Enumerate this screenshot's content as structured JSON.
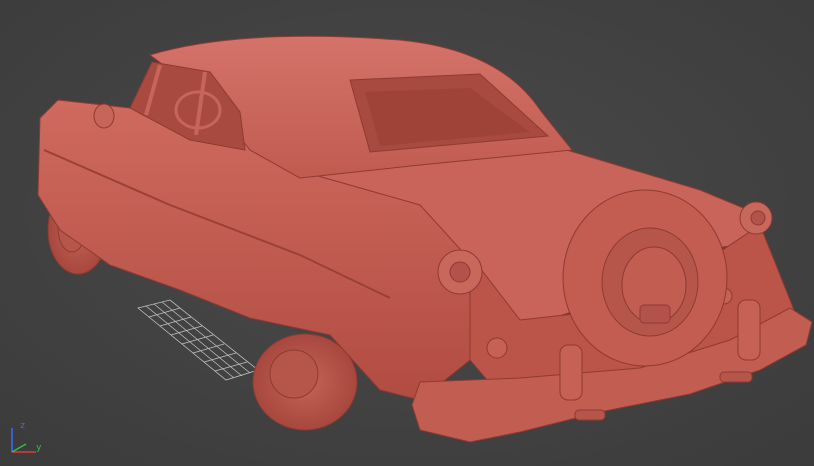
{
  "viewport": {
    "background": "#444444",
    "model": "car-body",
    "model_color": "#c35a4f",
    "grid_color": "#cfcfcf"
  },
  "axis_gizmo": {
    "z_label": "z",
    "y_label": "y",
    "z_color": "#3b6cff",
    "y_color": "#30c040",
    "x_color": "#e03a3a"
  }
}
